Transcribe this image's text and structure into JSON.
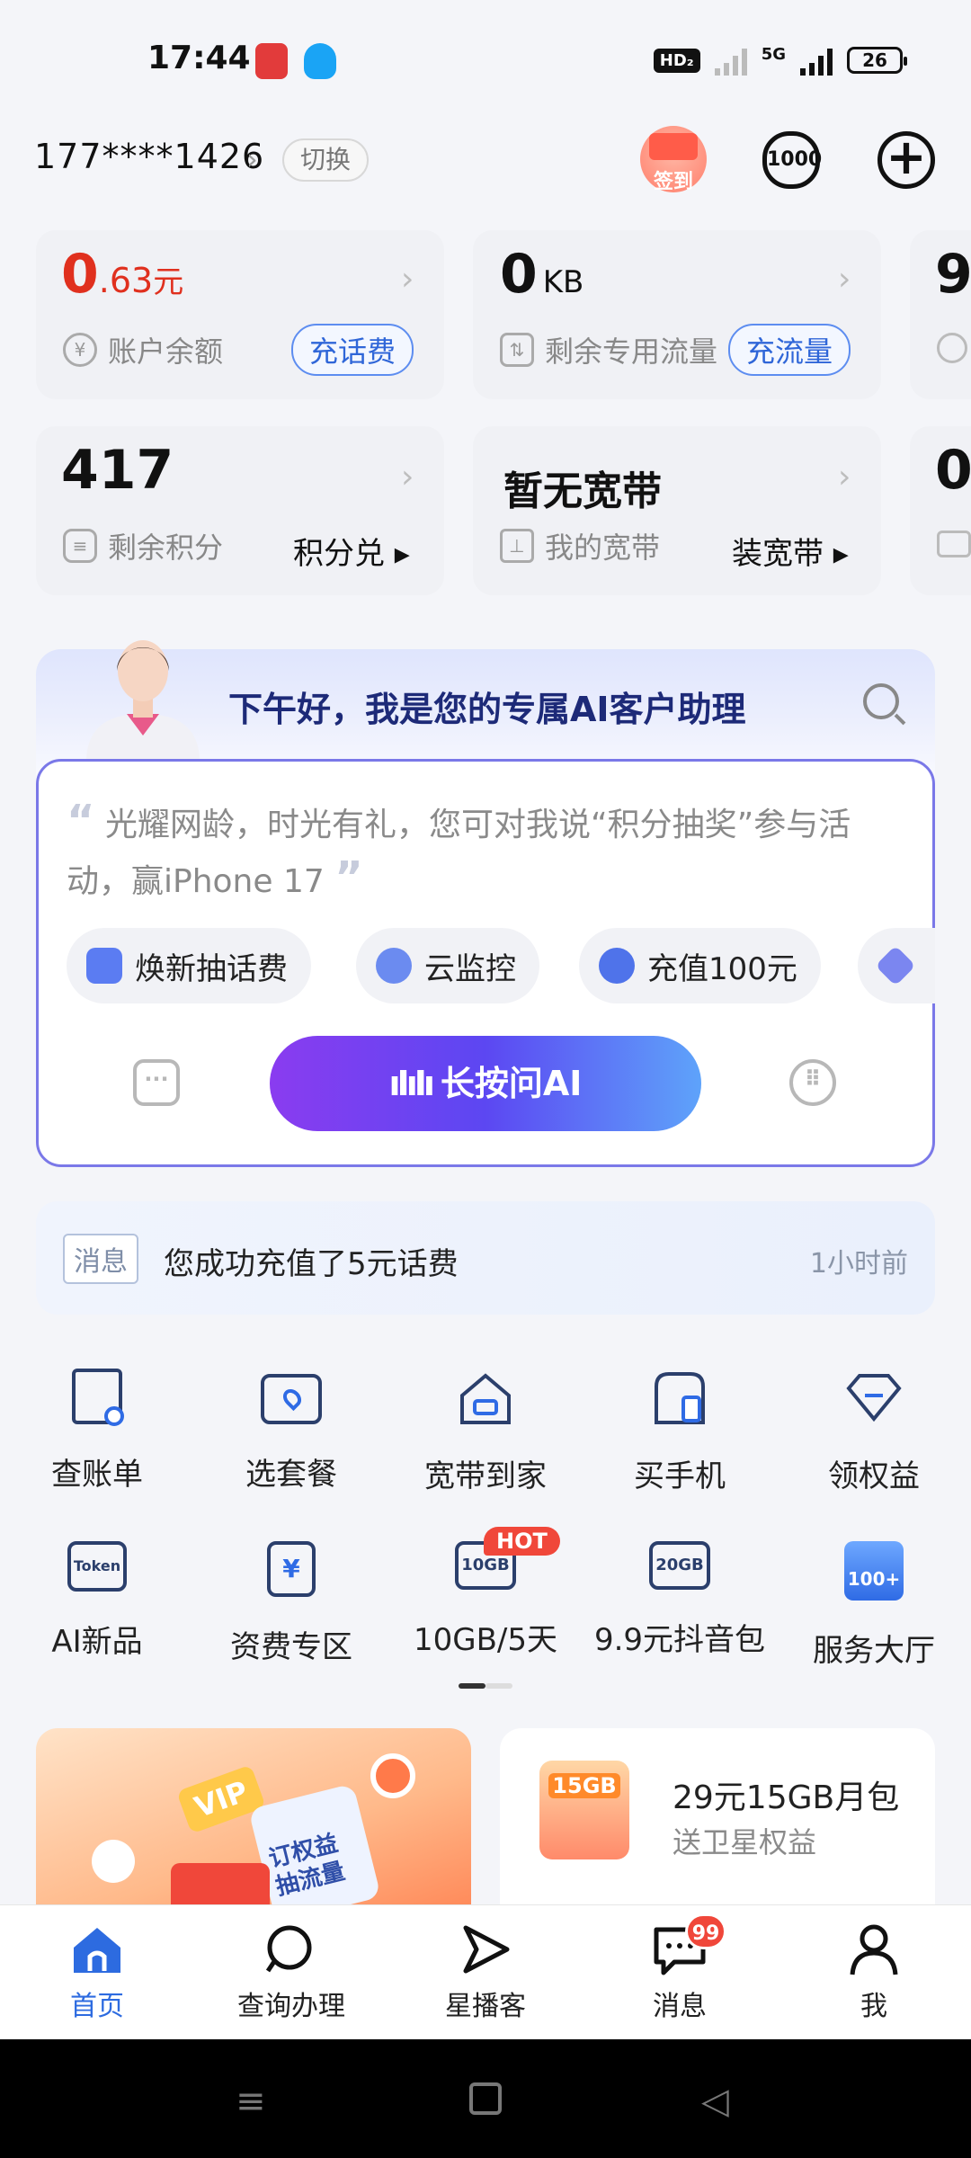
{
  "status": {
    "time": "17:44",
    "hd": "HD₂",
    "network": "5G",
    "battery": "26"
  },
  "header": {
    "phone": "177****1426",
    "switch_label": "切换",
    "signin_label": "签到",
    "service_label": "1000"
  },
  "cards": {
    "balance": {
      "value_int": "0",
      "value_dec": ".63",
      "unit": "元",
      "label": "账户余额",
      "action": "充话费"
    },
    "data": {
      "value": "0",
      "unit": "KB",
      "label": "剩余专用流量",
      "action": "充流量"
    },
    "partial_top": {
      "value": "9"
    },
    "points": {
      "value": "417",
      "label": "剩余积分",
      "action": "积分兑"
    },
    "broadband": {
      "value": "暂无宽带",
      "label": "我的宽带",
      "action": "装宽带"
    },
    "partial_bottom": {
      "value": "0."
    }
  },
  "ai": {
    "title": "下午好，我是您的专属AI客户助理",
    "quote_open": "“",
    "quote": "光耀网龄，时光有礼，您可对我说“积分抽奖”参与活动，赢iPhone 17",
    "quote_close": "”",
    "chips": [
      "焕新抽话费",
      "云监控",
      "充值100元"
    ],
    "ask_button": "长按问AI",
    "colors": {
      "gradient_start": "#8a3cf0",
      "gradient_end": "#5ea3fa"
    }
  },
  "message": {
    "tag": "消息",
    "text": "您成功充值了5元话费",
    "time": "1小时前"
  },
  "grid_row1": [
    {
      "label": "查账单",
      "icon": "bill-search-icon"
    },
    {
      "label": "选套餐",
      "icon": "folder-plan-icon"
    },
    {
      "label": "宽带到家",
      "icon": "home-broadband-icon"
    },
    {
      "label": "买手机",
      "icon": "phone-store-icon"
    },
    {
      "label": "领权益",
      "icon": "diamond-icon"
    }
  ],
  "grid_row2": [
    {
      "label": "AI新品",
      "icon": "token-icon",
      "icon_text": "Token"
    },
    {
      "label": "资费专区",
      "icon": "tariff-icon",
      "icon_text": "¥"
    },
    {
      "label": "10GB/5天",
      "icon": "10gb-icon",
      "icon_text": "10GB"
    },
    {
      "label": "9.9元抖音包",
      "icon": "20gb-icon",
      "icon_text": "20GB"
    },
    {
      "label": "服务大厅",
      "icon": "service-hall-icon",
      "icon_text": "100+"
    }
  ],
  "hot_badge": "HOT",
  "promo": {
    "left_text": "订权益 抽流量",
    "left_vip": "VIP",
    "right_img_text": "15GB",
    "right_title": "29元15GB月包",
    "right_sub": "送卫星权益"
  },
  "tabs": [
    {
      "label": "首页",
      "active": true
    },
    {
      "label": "查询办理"
    },
    {
      "label": "星播客"
    },
    {
      "label": "消息",
      "badge": "99"
    },
    {
      "label": "我"
    }
  ],
  "colors": {
    "accent": "#2d6be0",
    "red": "#e0301e",
    "badge": "#f0473a"
  }
}
